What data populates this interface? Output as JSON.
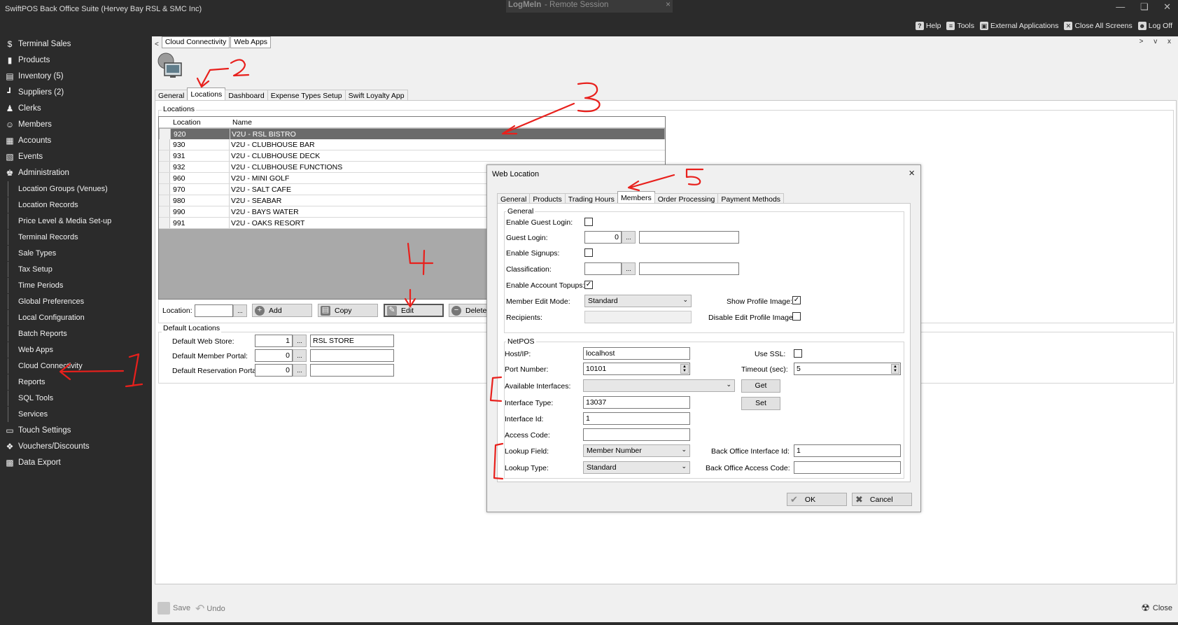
{
  "window": {
    "title": "SwiftPOS Back Office Suite (Hervey Bay RSL & SMC Inc)",
    "remote_brand": "LogMeIn",
    "remote_sub": "- Remote Session",
    "remote_close": "×"
  },
  "toolbar": {
    "help": "Help",
    "tools": "Tools",
    "external": "External Applications",
    "close_all": "Close All Screens",
    "logoff": "Log Off"
  },
  "sidebar": {
    "items": [
      {
        "label": "Terminal Sales",
        "icon": "dollar-icon"
      },
      {
        "label": "Products",
        "icon": "bottles-icon"
      },
      {
        "label": "Inventory (5)",
        "icon": "inventory-icon"
      },
      {
        "label": "Suppliers (2)",
        "icon": "trolley-icon"
      },
      {
        "label": "Clerks",
        "icon": "clerk-icon"
      },
      {
        "label": "Members",
        "icon": "member-icon"
      },
      {
        "label": "Accounts",
        "icon": "accounts-icon"
      },
      {
        "label": "Events",
        "icon": "calendar-icon"
      },
      {
        "label": "Administration",
        "icon": "admin-icon"
      }
    ],
    "admin_sub": [
      "Location Groups (Venues)",
      "Location Records",
      "Price Level & Media Set-up",
      "Terminal Records",
      "Sale Types",
      "Tax Setup",
      "Time Periods",
      "Global Preferences",
      "Local Configuration",
      "Batch Reports",
      "Web Apps",
      "Cloud Connectivity",
      "Reports",
      "SQL Tools",
      "Services"
    ],
    "bottom_items": [
      {
        "label": "Touch Settings",
        "icon": "monitor-icon"
      },
      {
        "label": "Vouchers/Discounts",
        "icon": "voucher-icon"
      },
      {
        "label": "Data Export",
        "icon": "export-icon"
      }
    ]
  },
  "doc_tabs": [
    "Cloud Connectivity",
    "Web Apps"
  ],
  "doc_nav": "> v x",
  "page_tabs": [
    "General",
    "Locations",
    "Dashboard",
    "Expense Types Setup",
    "Swift Loyalty App"
  ],
  "locations": {
    "group_label": "Locations",
    "col_location": "Location",
    "col_name": "Name",
    "rows": [
      {
        "code": "920",
        "name": "V2U - RSL BISTRO"
      },
      {
        "code": "930",
        "name": "V2U - CLUBHOUSE BAR"
      },
      {
        "code": "931",
        "name": "V2U - CLUBHOUSE DECK"
      },
      {
        "code": "932",
        "name": "V2U - CLUBHOUSE FUNCTIONS"
      },
      {
        "code": "960",
        "name": "V2U - MINI GOLF"
      },
      {
        "code": "970",
        "name": "V2U - SALT CAFE"
      },
      {
        "code": "980",
        "name": "V2U - SEABAR"
      },
      {
        "code": "990",
        "name": "V2U - BAYS WATER"
      },
      {
        "code": "991",
        "name": "V2U - OAKS RESORT"
      }
    ],
    "location_label": "Location:",
    "location_value": "",
    "ellipsis": "...",
    "add": "Add",
    "copy": "Copy",
    "edit": "Edit",
    "delete": "Delete"
  },
  "defaults": {
    "group_label": "Default Locations",
    "web_store_label": "Default Web Store:",
    "web_store_value": "1",
    "web_store_name": "RSL STORE",
    "member_portal_label": "Default Member Portal:",
    "member_portal_value": "0",
    "member_portal_name": "",
    "reservation_portal_label": "Default Reservation Portal:",
    "reservation_portal_value": "0",
    "reservation_portal_name": ""
  },
  "bottom": {
    "save": "Save",
    "undo": "Undo",
    "close": "Close"
  },
  "dialog": {
    "title": "Web Location",
    "close": "×",
    "tabs": [
      "General",
      "Products",
      "Trading Hours",
      "Members",
      "Order Processing",
      "Payment Methods"
    ],
    "general_group": "General",
    "enable_guest_login_label": "Enable Guest Login:",
    "enable_guest_login": false,
    "guest_login_label": "Guest Login:",
    "guest_login_value": "0",
    "guest_login_name": "",
    "enable_signups_label": "Enable Signups:",
    "enable_signups": false,
    "classification_label": "Classification:",
    "classification_value": "",
    "classification_name": "",
    "enable_account_topups_label": "Enable Account Topups:",
    "enable_account_topups": true,
    "member_edit_mode_label": "Member Edit Mode:",
    "member_edit_mode_value": "Standard",
    "show_profile_image_label": "Show Profile Image:",
    "show_profile_image": true,
    "recipients_label": "Recipients:",
    "disable_edit_profile_image_label": "Disable Edit Profile Image:",
    "disable_edit_profile_image": false,
    "netpos_group": "NetPOS",
    "host_label": "Host/IP:",
    "host_value": "localhost",
    "use_ssl_label": "Use SSL:",
    "use_ssl": false,
    "port_label": "Port Number:",
    "port_value": "10101",
    "timeout_label": "Timeout (sec):",
    "timeout_value": "5",
    "available_interfaces_label": "Available Interfaces:",
    "available_interfaces_value": "",
    "get_button": "Get",
    "interface_type_label": "Interface Type:",
    "interface_type_value": "13037",
    "set_button": "Set",
    "interface_id_label": "Interface Id:",
    "interface_id_value": "1",
    "access_code_label": "Access Code:",
    "access_code_value": "",
    "lookup_field_label": "Lookup Field:",
    "lookup_field_value": "Member Number",
    "bo_interface_id_label": "Back Office Interface Id:",
    "bo_interface_id_value": "1",
    "lookup_type_label": "Lookup Type:",
    "lookup_type_value": "Standard",
    "bo_access_code_label": "Back Office Access Code:",
    "bo_access_code_value": "",
    "ok": "OK",
    "cancel": "Cancel"
  },
  "annotations": [
    "1",
    "2",
    "3",
    "4",
    "5"
  ],
  "colors": {
    "annotation": "#e8201c",
    "sidebar_bg": "#2b2b2b",
    "selected_row": "#6b6b6b"
  }
}
